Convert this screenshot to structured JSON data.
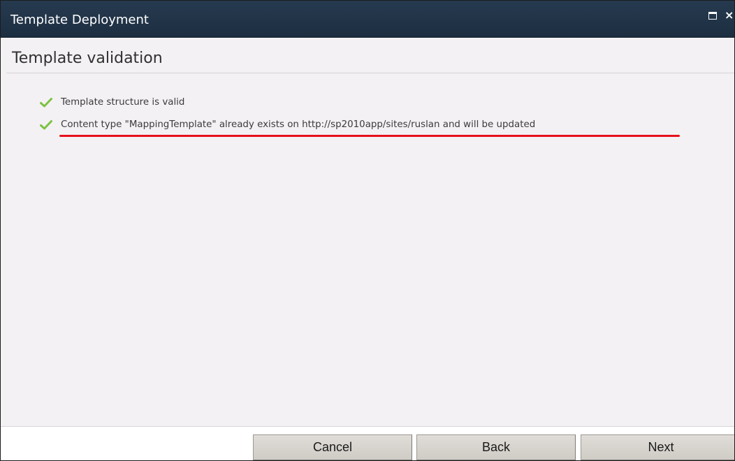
{
  "window": {
    "title": "Template Deployment",
    "maximize_icon": "maximize-icon",
    "close_icon": "close-icon",
    "close_glyph": "×"
  },
  "page": {
    "heading": "Template validation"
  },
  "messages": [
    {
      "status": "success",
      "icon": "check-icon",
      "text": "Template structure is valid",
      "highlighted": false
    },
    {
      "status": "success",
      "icon": "check-icon",
      "text": "Content type \"MappingTemplate\" already exists on http://sp2010app/sites/ruslan and will be updated",
      "highlighted": true
    }
  ],
  "buttons": {
    "cancel": "Cancel",
    "back": "Back",
    "next": "Next"
  },
  "colors": {
    "titlebar": "#213447",
    "check": "#7cc242",
    "highlight_underline": "#e8111a",
    "content_background": "#f4f1f4"
  }
}
